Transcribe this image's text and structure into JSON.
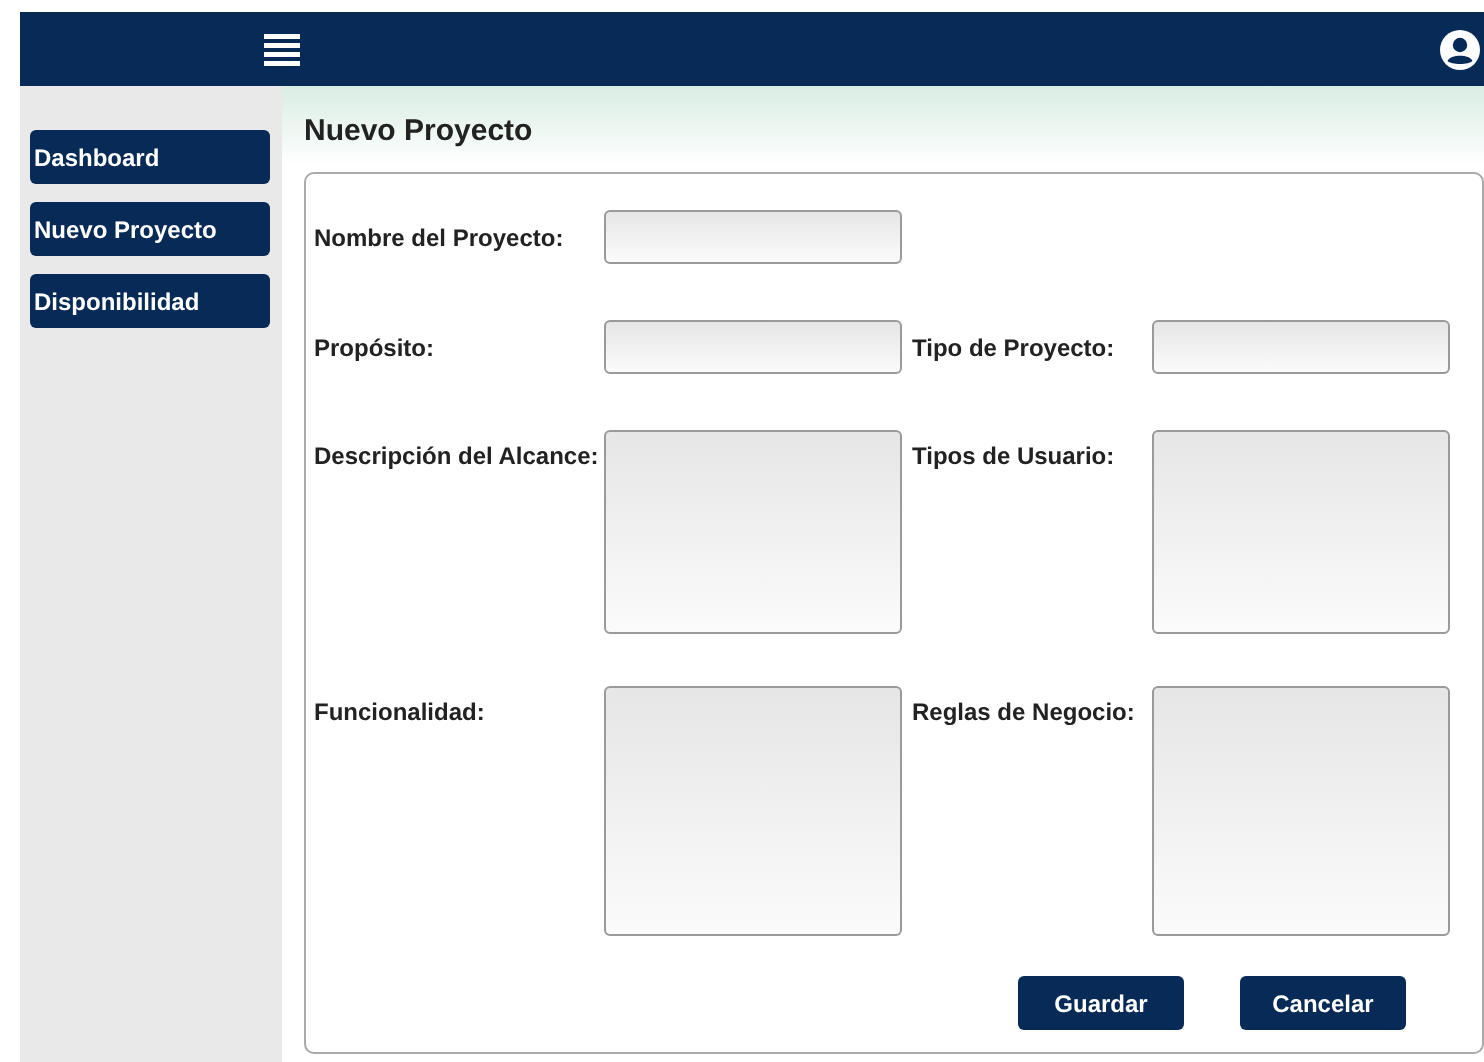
{
  "sidebar": {
    "items": [
      {
        "label": "Dashboard"
      },
      {
        "label": "Nuevo Proyecto"
      },
      {
        "label": "Disponibilidad"
      }
    ]
  },
  "page": {
    "title": "Nuevo Proyecto"
  },
  "form": {
    "rows": [
      {
        "fields": [
          {
            "label": "Nombre del Proyecto:",
            "kind": "text"
          }
        ]
      },
      {
        "fields": [
          {
            "label": "Propósito:",
            "kind": "text"
          },
          {
            "label": "Tipo de Proyecto:",
            "kind": "text"
          }
        ]
      },
      {
        "fields": [
          {
            "label": "Descripción del Alcance:",
            "kind": "textarea"
          },
          {
            "label": "Tipos de Usuario:",
            "kind": "textarea"
          }
        ]
      },
      {
        "fields": [
          {
            "label": "Funcionalidad:",
            "kind": "textarea"
          },
          {
            "label": "Reglas de Negocio:",
            "kind": "textarea"
          }
        ]
      }
    ],
    "buttons": [
      {
        "label": "Guardar"
      },
      {
        "label": "Cancelar"
      }
    ]
  }
}
